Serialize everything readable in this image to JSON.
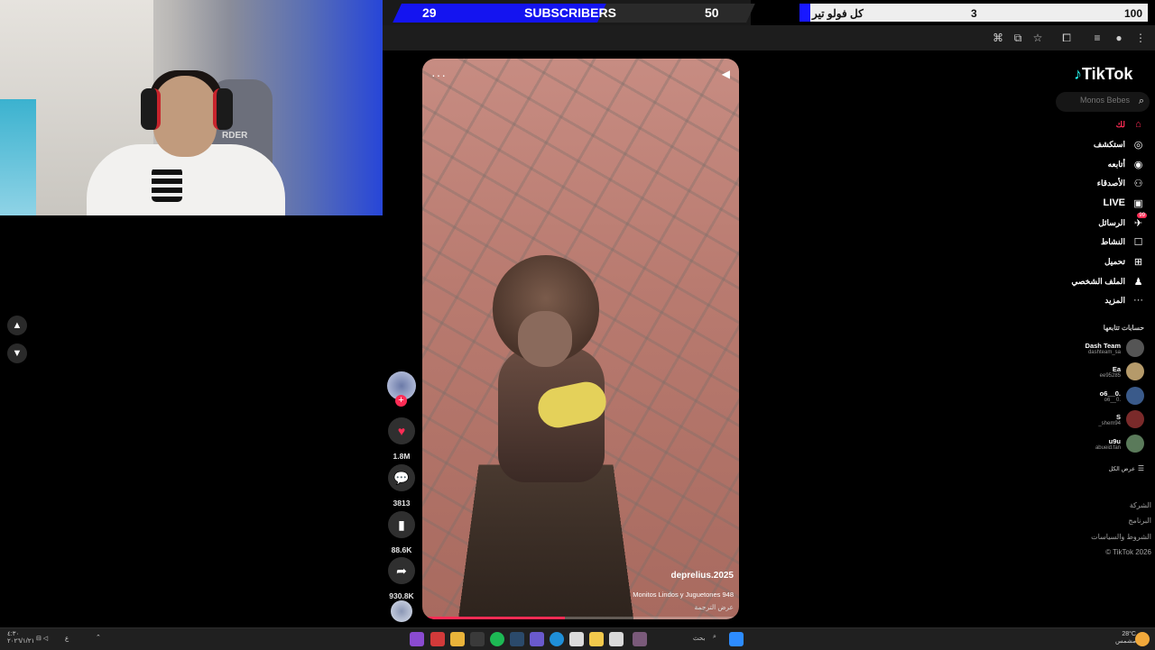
{
  "goal_bar": {
    "current": "29",
    "label": "SUBSCRIBERS",
    "target": "50",
    "progress": 0.58
  },
  "goal_bar_2": {
    "label": "كل فولو تير",
    "current": "3",
    "target": "100",
    "progress": 0.03
  },
  "tiktok": {
    "logo": "TikTok",
    "search_placeholder": "Monos Bebes",
    "nav": [
      {
        "label": "لك",
        "icon": "home-icon",
        "active": true
      },
      {
        "label": "استكشف",
        "icon": "compass-icon"
      },
      {
        "label": "أتابعه",
        "icon": "following-icon"
      },
      {
        "label": "الأصدقاء",
        "icon": "friends-icon"
      },
      {
        "label": "LIVE",
        "icon": "live-icon"
      },
      {
        "label": "الرسائل",
        "icon": "messages-icon",
        "badge": "99"
      },
      {
        "label": "النشاط",
        "icon": "activity-icon"
      },
      {
        "label": "تحميل",
        "icon": "upload-icon"
      },
      {
        "label": "الملف الشخصي",
        "icon": "profile-icon"
      },
      {
        "label": "المزيد",
        "icon": "more-icon"
      }
    ],
    "following_title": "حسابات تتابعها",
    "following": [
      {
        "name": "Dash Team",
        "handle": "dashteam_sa",
        "color": "#555555"
      },
      {
        "name": "Ea",
        "handle": "ee95285",
        "color": "#b59a6a"
      },
      {
        "name": "o6__0.",
        "handle": "o6__0.",
        "color": "#3a5a8a"
      },
      {
        "name": "S",
        "handle": "_shem94",
        "color": "#7a2a2a"
      },
      {
        "name": "u9u",
        "handle": "abueid.fan",
        "color": "#5a7a5a"
      }
    ],
    "see_all": "عرض الكل",
    "footer": [
      "الشركة",
      "البرنامج",
      "الشروط والسياسات",
      "© TikTok 2026"
    ],
    "video": {
      "author": "deprelius.2025",
      "caption": "Monitos Lindos y Juguetones 948",
      "translate": "عرض الترجمة",
      "progress": 0.45
    },
    "actions": {
      "likes": "1.8M",
      "comments": "3813",
      "saves": "88.6K",
      "shares": "930.8K"
    }
  },
  "webcam": {
    "brand_text": "RDER"
  },
  "taskbar": {
    "weather": "28°C",
    "weather_sub": "مشمس",
    "time": "٤:٣٠",
    "date": "٢٠٢٦/١/٢١",
    "search": "بحث",
    "lang": "ع"
  },
  "colors": {
    "accent": "#fe2c55",
    "goal_blue": "#1818ff"
  }
}
